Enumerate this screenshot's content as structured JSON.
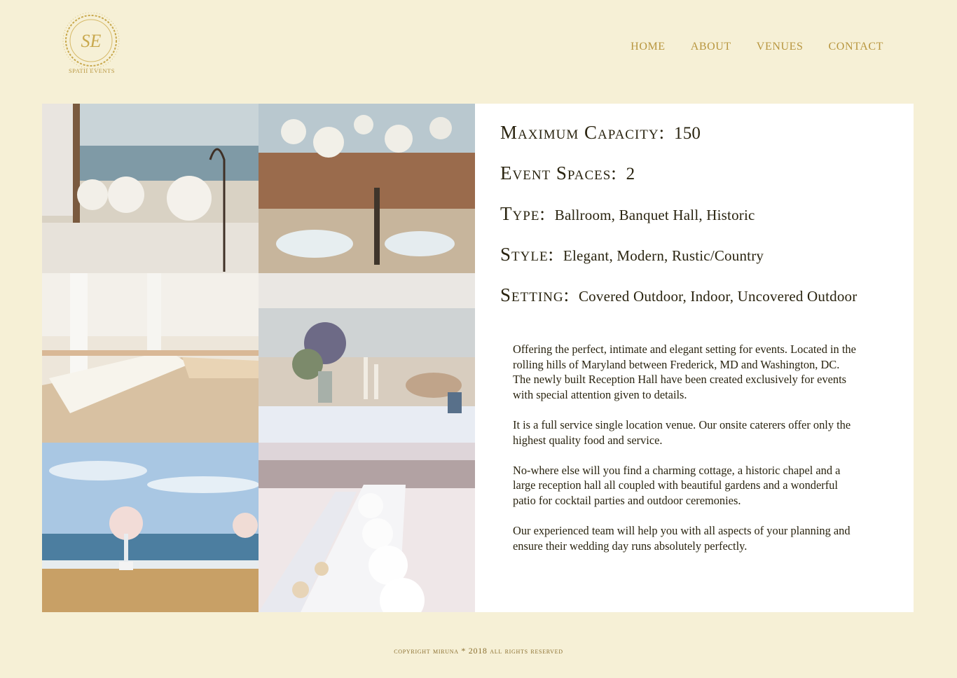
{
  "brand": {
    "logo_monogram": "SE",
    "logo_text": "SPATII EVENTS"
  },
  "nav": {
    "items": [
      "HOME",
      "ABOUT",
      "VENUES",
      "CONTACT"
    ]
  },
  "gallery": {
    "images": [
      "beach-ceremony-roses-photo",
      "courtyard-lanterns-reception-photo",
      "tent-banquet-tables-photo",
      "beach-table-centerpiece-photo",
      "ocean-ceremony-chairs-photo",
      "white-floral-long-table-photo"
    ]
  },
  "details": {
    "capacity_label": "Maximum Capacity:",
    "capacity_value": "150",
    "spaces_label": "Event Spaces:",
    "spaces_value": "2",
    "type_label": "Type:",
    "type_value": "Ballroom, Banquet Hall, Historic",
    "style_label": "Style:",
    "style_value": "Elegant, Modern, Rustic/Country",
    "setting_label": "Setting:",
    "setting_value": "Covered Outdoor, Indoor, Uncovered Outdoor"
  },
  "description": {
    "p1": "Offering the perfect, intimate and elegant setting for events. Located in the rolling hills of  Maryland between Frederick, MD and Washington, DC. The newly built Reception Hall have been created exclusively for events with special attention given to details.",
    "p2": "It is a full service single location venue. Our onsite caterers offer only the highest quality food and service.",
    "p3": "No-where else will you find a charming cottage, a historic chapel and a large reception hall all coupled with beautiful gardens and a wonderful patio for cocktail parties and outdoor ceremonies.",
    "p4": "Our experienced team will help you with all aspects of  your planning and ensure their wedding day runs absolutely perfectly."
  },
  "footer": {
    "text": "copyright miruna * 2018 all rights reserved"
  },
  "colors": {
    "background": "#f6f0d6",
    "gold": "#b8963f",
    "text": "#2a2410",
    "panel": "#ffffff"
  }
}
